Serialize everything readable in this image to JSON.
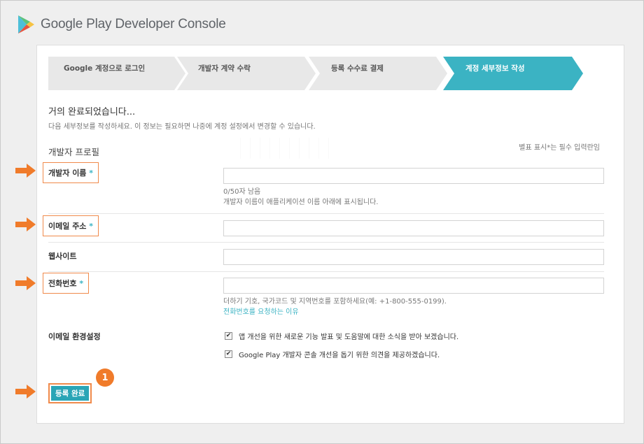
{
  "header": {
    "title": "Google Play Developer Console"
  },
  "steps": [
    {
      "label": "Google 계정으로 로그인",
      "active": false
    },
    {
      "label": "개발자 계약 수락",
      "active": false
    },
    {
      "label": "등록 수수료 결제",
      "active": false
    },
    {
      "label": "계정 세부정보 작성",
      "active": true
    }
  ],
  "intro": {
    "title": "거의 완료되었습니다...",
    "subtitle": "다음 세부정보를 작성하세요. 이 정보는 필요하면 나중에 계정 설정에서 변경할 수 있습니다."
  },
  "profile": {
    "section_title": "개발자 프로필",
    "required_note": "별표 표시*는 필수 입력란임",
    "developer_name": {
      "label": "개발자 이름",
      "required": "*",
      "value": "",
      "counter": "0/50자 남음",
      "hint": "개발자 이름이 애플리케이션 이름 아래에 표시됩니다."
    },
    "email": {
      "label": "이메일 주소",
      "required": "*",
      "value": ""
    },
    "website": {
      "label": "웹사이트",
      "value": ""
    },
    "phone": {
      "label": "전화번호",
      "required": "*",
      "value": "",
      "hint": "더하기 기호, 국가코드 및 지역번호를 포함하세요(예: +1-800-555-0199).",
      "link": "전화번호를 요청하는 이유"
    },
    "email_prefs": {
      "label": "이메일 환경설정",
      "options": [
        {
          "label": "앱 개선을 위한 새로운 기능 발표 및 도움말에 대한 소식을 받아 보겠습니다.",
          "checked": true
        },
        {
          "label": "Google Play 개발자 콘솔 개선을 돕기 위한 의견을 제공하겠습니다.",
          "checked": true
        }
      ]
    }
  },
  "actions": {
    "submit_label": "등록 완료"
  },
  "annotations": {
    "step_badge": "1"
  },
  "colors": {
    "accent": "#3bb3c3",
    "highlight": "#f08a4b",
    "badge": "#f07b2a"
  }
}
